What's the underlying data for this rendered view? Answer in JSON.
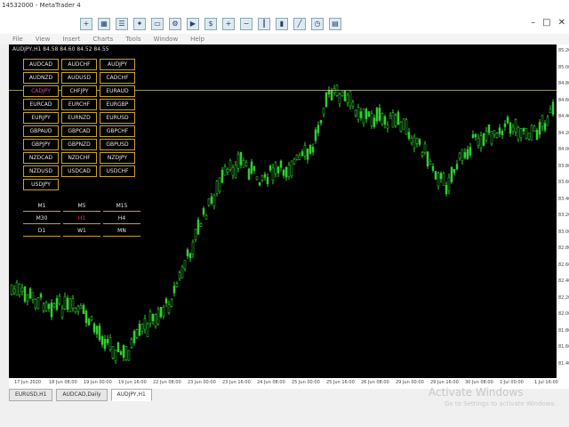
{
  "window": {
    "title": "14532000 - MetaTrader 4"
  },
  "chart": {
    "title": "AUDJPY,H1 84.58 84.60 84.52 84.55"
  },
  "menu": [
    "File",
    "View",
    "Insert",
    "Charts",
    "Tools",
    "Window",
    "Help"
  ],
  "toolbar": [
    "new-chart",
    "profiles",
    "market-watch",
    "navigator",
    "terminal",
    "tester",
    "autotrading",
    "new-order",
    "zoom-in",
    "zoom-out",
    "bar-chart",
    "candles",
    "line-chart",
    "period",
    "templates"
  ],
  "symbols": [
    "AUDCAD",
    "AUDCHF",
    "AUDJPY",
    "AUDNZD",
    "AUDUSD",
    "CADCHF",
    "CADJPY",
    "CHFJPY",
    "EURAUD",
    "EURCAD",
    "EURCHF",
    "EURGBP",
    "EURJPY",
    "EURNZD",
    "EURUSD",
    "GBPAUD",
    "GBPCAD",
    "GBPCHF",
    "GBPJPY",
    "GBPNZD",
    "GBPUSD",
    "NZDCAD",
    "NZDCHF",
    "NZDJPY",
    "NZDUSD",
    "USDCAD",
    "USDCHF",
    "USDJPY"
  ],
  "selected_symbol": "CADJPY",
  "timeframes": [
    "M1",
    "M5",
    "M15",
    "M30",
    "H1",
    "H4",
    "D1",
    "W1",
    "MN"
  ],
  "selected_timeframe": "H1",
  "tabs": [
    "EURUSD,H1",
    "AUDCAD,Daily",
    "AUDJPY,H1"
  ],
  "active_tab": "AUDJPY,H1",
  "watermark": {
    "line1": "Activate Windows",
    "line2": "Go to Settings to activate Windows."
  },
  "price_axis": [
    "85.20",
    "85.00",
    "84.80",
    "84.60",
    "84.40",
    "84.20",
    "84.00",
    "83.80",
    "83.60",
    "83.40",
    "83.20",
    "83.00",
    "82.80",
    "82.60",
    "82.40",
    "82.20",
    "82.00",
    "81.80",
    "81.60",
    "81.40"
  ],
  "time_axis": [
    "17 Jun 2020",
    "18 Jun 08:00",
    "19 Jun 00:00",
    "19 Jun 16:00",
    "22 Jun 08:00",
    "23 Jun 00:00",
    "23 Jun 16:00",
    "24 Jun 08:00",
    "25 Jun 00:00",
    "25 Jun 16:00",
    "26 Jun 08:00",
    "29 Jun 00:00",
    "29 Jun 16:00",
    "30 Jun 08:00",
    "1 Jul 00:00",
    "1 Jul 16:00"
  ],
  "colors": {
    "background": "#000000",
    "candle_up": "#32cd32",
    "candle_down": "#32cd32",
    "grid_border": "#c9a227",
    "highlight": "#e040c0"
  }
}
